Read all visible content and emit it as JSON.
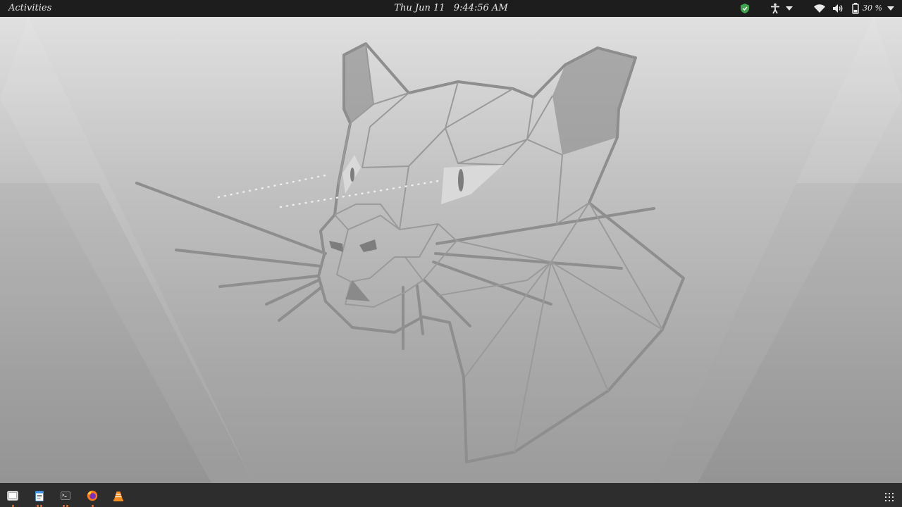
{
  "topbar": {
    "activities_label": "Activities",
    "clock_date": "Thu Jun 11",
    "clock_time": "9:44:56 AM",
    "battery_percent": "30 %"
  },
  "tray_icons": [
    "shield-update-icon",
    "accessibility-icon",
    "chevron-down-icon",
    "wifi-icon",
    "volume-icon",
    "battery-icon",
    "chevron-down-icon"
  ],
  "dock": {
    "items": [
      {
        "name": "files",
        "icon": "files-icon",
        "running_dots": 1
      },
      {
        "name": "text-editor",
        "icon": "text-editor-icon",
        "running_dots": 2
      },
      {
        "name": "terminal",
        "icon": "terminal-icon",
        "running_dots": 2
      },
      {
        "name": "firefox",
        "icon": "firefox-icon",
        "running_dots": 1
      },
      {
        "name": "vlc",
        "icon": "vlc-icon",
        "running_dots": 0
      }
    ],
    "show_apps_icon": "app-grid-icon"
  },
  "colors": {
    "topbar_bg": "#1d1d1d",
    "dock_bg": "#2d2d2d",
    "running_indicator": "#e8723a",
    "wallpaper_line": "#8a8a8a"
  }
}
